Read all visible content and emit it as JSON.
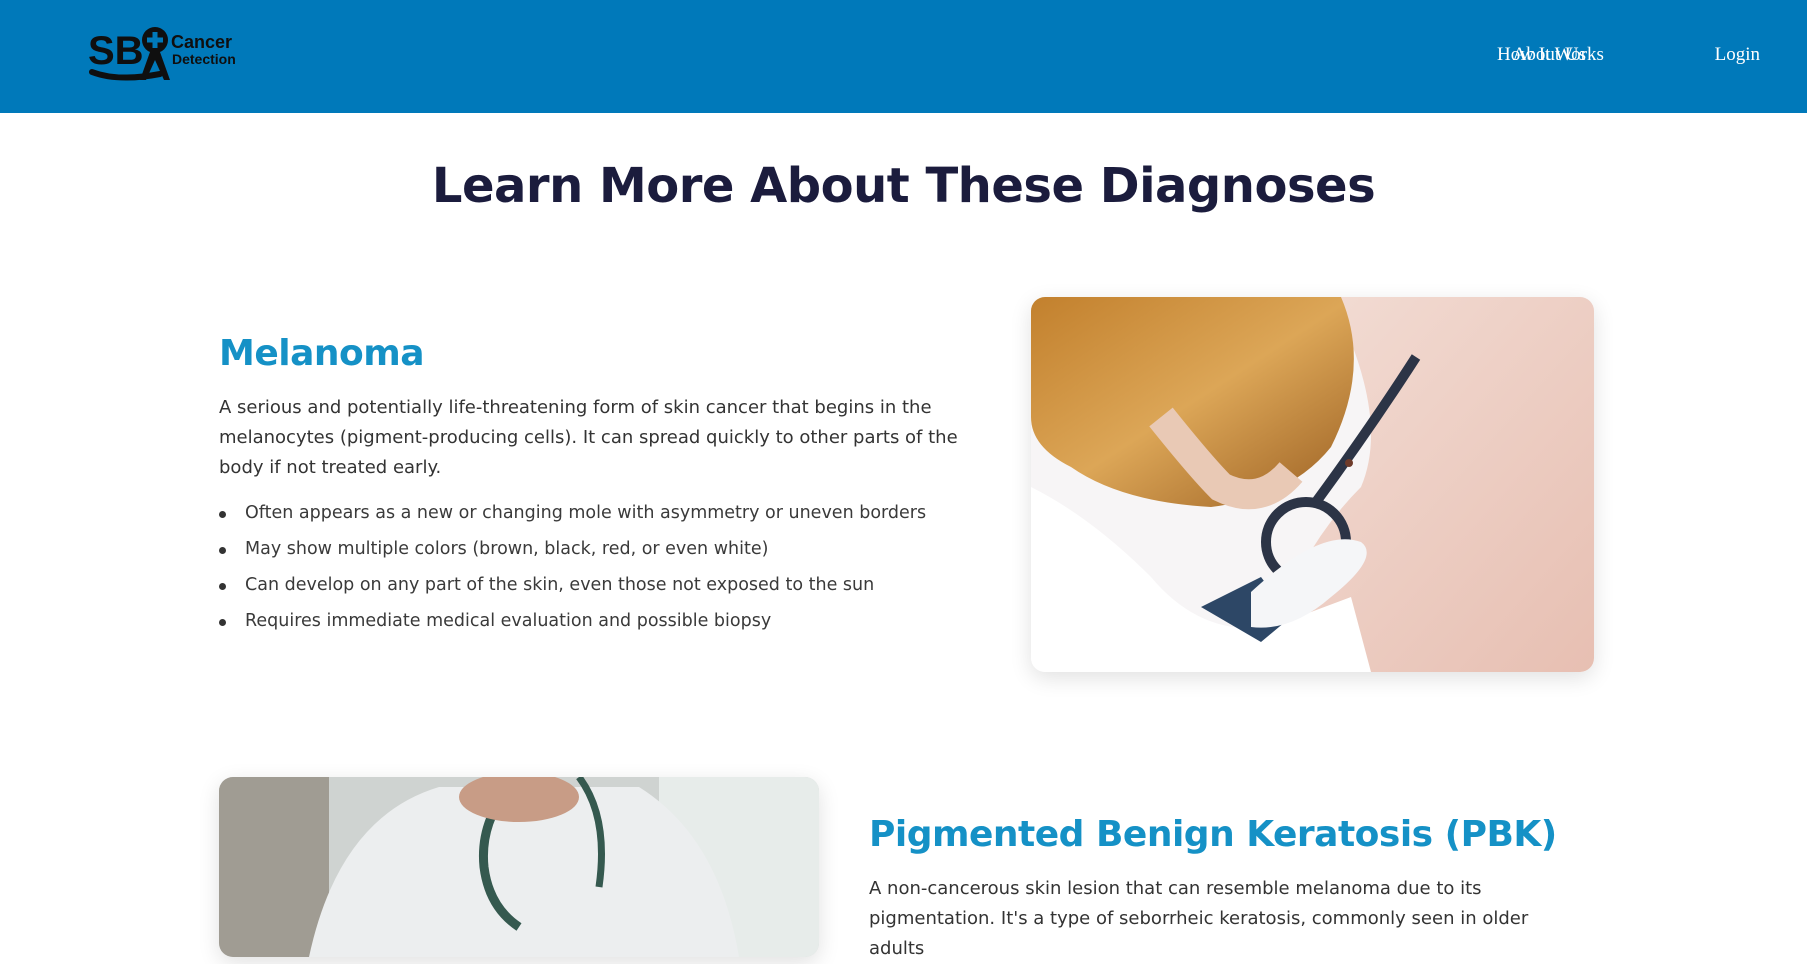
{
  "header": {
    "logo": {
      "text_main": "SB",
      "text_line1": "Cancer",
      "text_line2": "Detection",
      "icon": "cancer-ribbon-cross-icon"
    },
    "nav": [
      {
        "label": "About Us"
      },
      {
        "label": "How It Works"
      },
      {
        "label": "Login"
      }
    ],
    "background": "#0079ba"
  },
  "main": {
    "title": "Learn More About These Diagnoses",
    "sections": [
      {
        "title": "Melanoma",
        "description": "A serious and potentially life-threatening form of skin cancer that begins in the melanocytes (pigment-producing cells). It can spread quickly to other parts of the body if not treated early.",
        "bullets": [
          "Often appears as a new or changing mole with asymmetry or uneven borders",
          "May show multiple colors (brown, black, red, or even white)",
          "Can develop on any part of the skin, even those not exposed to the sun",
          "Requires immediate medical evaluation and possible biopsy"
        ],
        "image": "doctor-examining-skin-with-magnifier"
      },
      {
        "title": "Pigmented Benign Keratosis (PBK)",
        "description": "A non-cancerous skin lesion that can resemble melanoma due to its pigmentation. It's a type of seborrheic keratosis, commonly seen in older adults",
        "image": "doctor-in-white-coat-with-stethoscope"
      }
    ]
  },
  "colors": {
    "title": "#1b1c3d",
    "section_title": "#1591c6",
    "text": "#333333"
  }
}
